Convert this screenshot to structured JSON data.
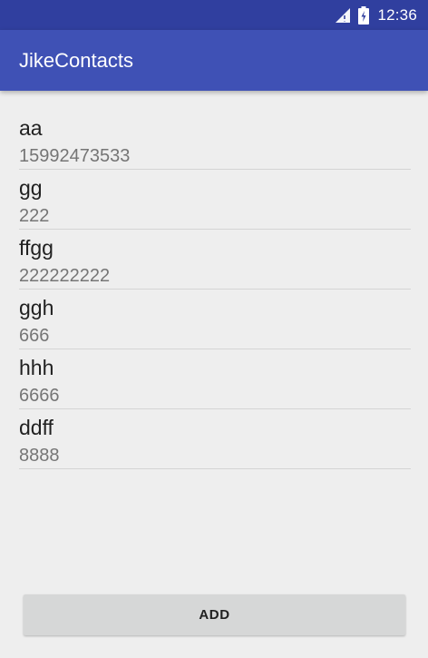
{
  "status_bar": {
    "time": "12:36",
    "icons": [
      "signal-icon",
      "battery-charging-icon"
    ]
  },
  "app_bar": {
    "title": "JikeContacts"
  },
  "contacts": [
    {
      "name": "aa",
      "phone": "15992473533"
    },
    {
      "name": "gg",
      "phone": "222"
    },
    {
      "name": "ffgg",
      "phone": "222222222"
    },
    {
      "name": "ggh",
      "phone": "666"
    },
    {
      "name": "hhh",
      "phone": "6666"
    },
    {
      "name": "ddff",
      "phone": "8888"
    }
  ],
  "add_button": {
    "label": "ADD"
  },
  "colors": {
    "status_bar": "#303f9f",
    "app_bar": "#3f51b5",
    "background": "#eeeeee",
    "button": "#d6d7d7"
  }
}
